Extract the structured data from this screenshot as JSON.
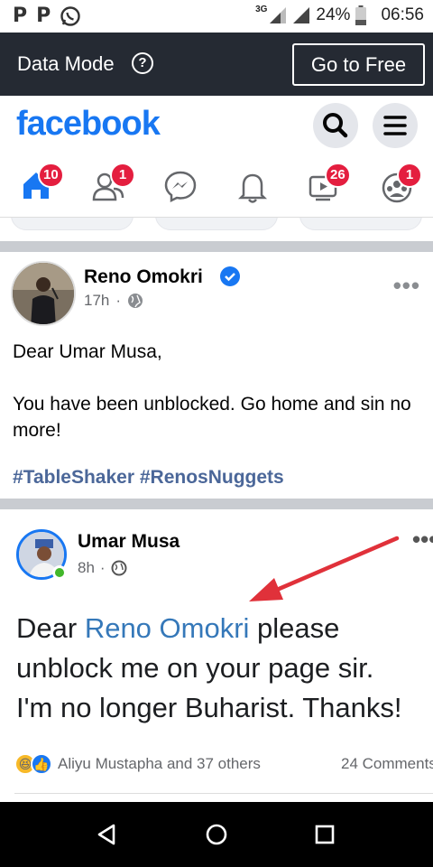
{
  "status_bar": {
    "notification_icons": [
      "P",
      "P",
      "whatsapp-icon"
    ],
    "network": "3G",
    "battery": "24%",
    "time": "06:56"
  },
  "data_mode": {
    "label": "Data Mode",
    "button": "Go to Free"
  },
  "header": {
    "logo": "facebook",
    "brand_color": "#1877f2"
  },
  "nav": {
    "home_badge": "10",
    "friends_badge": "1",
    "watch_badge": "26",
    "groups_badge": "1"
  },
  "post": {
    "author": "Reno Omokri",
    "time": "17h",
    "separator": "·",
    "lines": [
      "Dear Umar Musa,",
      "You have been unblocked. Go home and sin no more!"
    ],
    "hashtags": "#TableShaker #RenosNuggets"
  },
  "embedded_post": {
    "author": "Umar Musa",
    "time": "8h",
    "separator": "·",
    "text_prefix": "Dear ",
    "mention": "Reno Omokri",
    "text_suffix": " please",
    "line2": "unblock me on your page sir.",
    "line3": "I'm no longer Buharist. Thanks!",
    "reactions_text": "Aliyu Mustapha and 37 others",
    "comments_text": "24 Comments"
  }
}
